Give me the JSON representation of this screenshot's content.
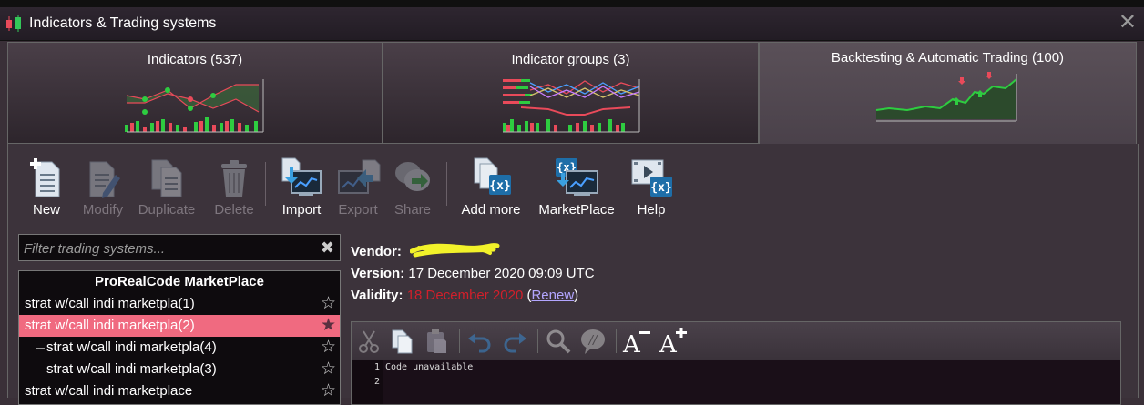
{
  "window": {
    "title": "Indicators & Trading systems",
    "close_glyph": "✕"
  },
  "tabs": [
    {
      "label": "Indicators (537)",
      "active": false,
      "icon": "indicators-chart-icon"
    },
    {
      "label": "Indicator groups (3)",
      "active": false,
      "icon": "indicator-groups-chart-icon"
    },
    {
      "label": "Backtesting & Automatic Trading (100)",
      "active": true,
      "icon": "backtesting-chart-icon"
    }
  ],
  "toolbar": {
    "new": "New",
    "modify": "Modify",
    "duplicate": "Duplicate",
    "delete": "Delete",
    "import": "Import",
    "export": "Export",
    "share": "Share",
    "add_more": "Add more",
    "marketplace": "MarketPlace",
    "help": "Help"
  },
  "filter": {
    "placeholder": "Filter trading systems...",
    "clear_glyph": "✖"
  },
  "list": {
    "header": "ProRealCode MarketPlace",
    "items": [
      {
        "label": "strat w/call indi marketpla(1)",
        "selected": false,
        "indent": false
      },
      {
        "label": "strat w/call indi marketpla(2)",
        "selected": true,
        "indent": false
      },
      {
        "label": "strat w/call indi marketpla(4)",
        "selected": false,
        "indent": true
      },
      {
        "label": "strat w/call indi marketpla(3)",
        "selected": false,
        "indent": true
      },
      {
        "label": "strat w/call indi marketplace",
        "selected": false,
        "indent": false
      }
    ],
    "star_glyph": "☆",
    "star_filled_glyph": "★"
  },
  "details": {
    "vendor_label": "Vendor:",
    "version_label": "Version:",
    "version_value": "17 December 2020 09:09 UTC",
    "validity_label": "Validity:",
    "validity_value": "18 December 2020",
    "renew_open": " (",
    "renew_link": "Renew",
    "renew_close": ")"
  },
  "editor": {
    "line_numbers": [
      "1",
      "2"
    ],
    "code": "Code unavailable"
  },
  "colors": {
    "accent_selected": "#f06a80",
    "validity_red": "#d21f2b",
    "link": "#b3a6ff"
  }
}
